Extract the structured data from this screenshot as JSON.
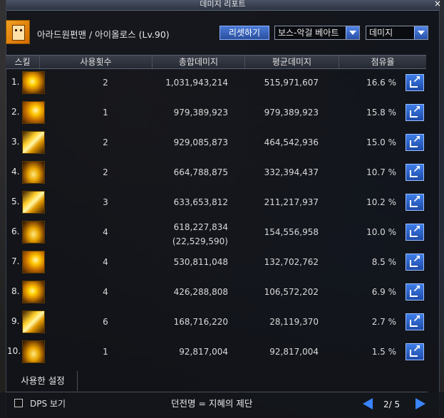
{
  "window": {
    "title": "데미지 리포트",
    "close_glyph": "×"
  },
  "header": {
    "character": "아라드원펀맨 / 아이올로스 (Lv.90)",
    "reset_label": "리셋하기",
    "filter_select": "보스-악걸 베아트",
    "metric_select": "데미지"
  },
  "columns": {
    "skill": "스킬",
    "uses": "사용횟수",
    "total": "총합데미지",
    "avg": "평균데미지",
    "share": "점유율"
  },
  "rows": [
    {
      "rank": "1.",
      "uses": "2",
      "total": "1,031,943,214",
      "total_sub": "",
      "avg": "515,971,607",
      "share": "16.6 %"
    },
    {
      "rank": "2.",
      "uses": "1",
      "total": "979,389,923",
      "total_sub": "",
      "avg": "979,389,923",
      "share": "15.8 %"
    },
    {
      "rank": "3.",
      "uses": "2",
      "total": "929,085,873",
      "total_sub": "",
      "avg": "464,542,936",
      "share": "15.0 %"
    },
    {
      "rank": "4.",
      "uses": "2",
      "total": "664,788,875",
      "total_sub": "",
      "avg": "332,394,437",
      "share": "10.7 %"
    },
    {
      "rank": "5.",
      "uses": "3",
      "total": "633,653,812",
      "total_sub": "",
      "avg": "211,217,937",
      "share": "10.2 %"
    },
    {
      "rank": "6.",
      "uses": "4",
      "total": "618,227,834",
      "total_sub": "(22,529,590)",
      "avg": "154,556,958",
      "share": "10.0 %"
    },
    {
      "rank": "7.",
      "uses": "4",
      "total": "530,811,048",
      "total_sub": "",
      "avg": "132,702,762",
      "share": "8.5 %"
    },
    {
      "rank": "8.",
      "uses": "4",
      "total": "426,288,808",
      "total_sub": "",
      "avg": "106,572,202",
      "share": "6.9 %"
    },
    {
      "rank": "9.",
      "uses": "6",
      "total": "168,716,220",
      "total_sub": "",
      "avg": "28,119,370",
      "share": "2.7 %"
    },
    {
      "rank": "10.",
      "uses": "1",
      "total": "92,817,004",
      "total_sub": "",
      "avg": "92,817,004",
      "share": "1.5 %"
    }
  ],
  "footer": {
    "settings_tab": "사용한 설정",
    "dps_label": "DPS 보기",
    "dungeon": "던전명 = 지혜의 제단",
    "page": "2/ 5"
  },
  "icons": [
    "skill-icon",
    "export-icon",
    "close-icon",
    "chevron-down-icon",
    "prev-arrow-icon",
    "next-arrow-icon"
  ],
  "colors": {
    "accent": "#3a84ff",
    "button": "#2a4f9e"
  }
}
